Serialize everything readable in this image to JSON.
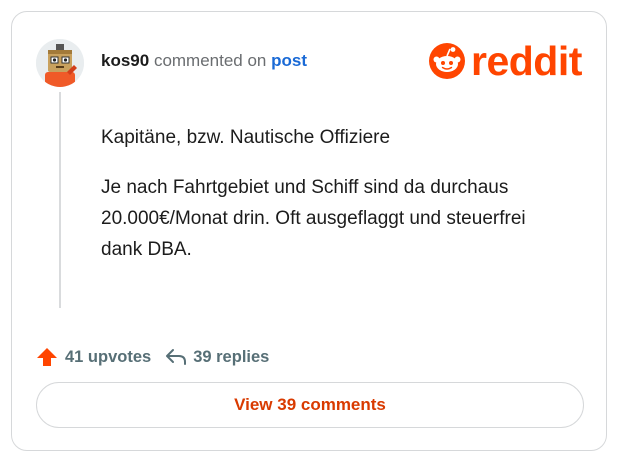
{
  "comment": {
    "username": "kos90",
    "commented_on": "commented on",
    "post_link": "post",
    "paragraphs": [
      "Kapitäne, bzw. Nautische Offiziere",
      "Je nach Fahrtgebiet und Schiff sind da durchaus 20.000€/Monat drin. Oft ausgeflaggt und steuerfrei dank DBA."
    ]
  },
  "brand": {
    "name": "reddit",
    "color": "#ff4500"
  },
  "actions": {
    "upvotes": "41 upvotes",
    "replies": "39 replies",
    "upvote_icon": "upvote-arrow-icon",
    "reply_icon": "reply-arrow-icon"
  },
  "view_comments": "View 39 comments"
}
